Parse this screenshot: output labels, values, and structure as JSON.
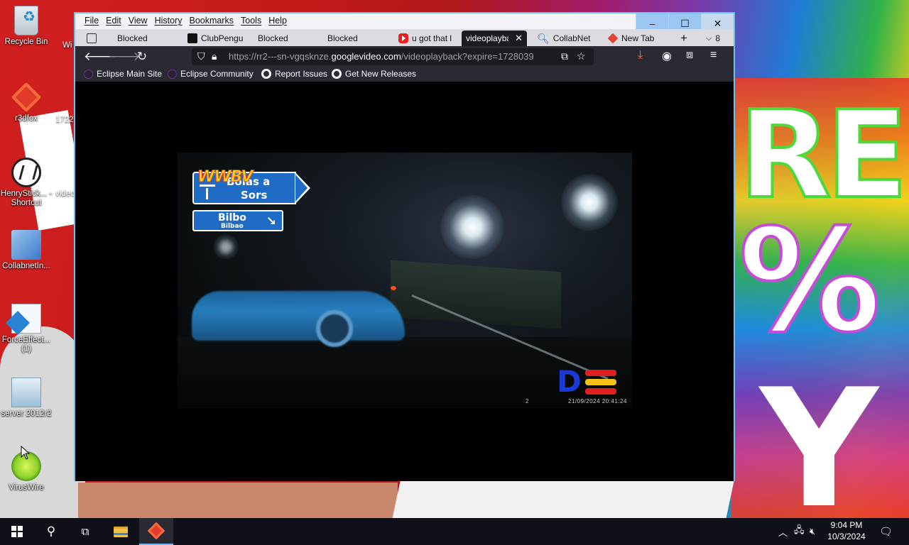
{
  "desktop": {
    "icons": [
      {
        "label": "Recycle Bin",
        "icon": "recycle-bin-icon"
      },
      {
        "label": "r3dfox",
        "icon": "r3dfox-icon"
      },
      {
        "label": "HenryStick... - Shortcut",
        "icon": "henry-stickmin-icon"
      },
      {
        "label": "CollabnetIn...",
        "icon": "collabnet-installer-icon"
      },
      {
        "label": "ForceEffect... (1)",
        "icon": "forceeffect-icon"
      },
      {
        "label": "server 2012r2",
        "icon": "server-icon"
      },
      {
        "label": "VirusWire",
        "icon": "viruswire-icon"
      }
    ],
    "clipped_labels": [
      "Wi",
      "1722",
      "video"
    ],
    "wallpaper_text": {
      "top": "RE",
      "middle": "%",
      "bottom": "Y"
    }
  },
  "browser": {
    "menu": [
      "File",
      "Edit",
      "View",
      "History",
      "Bookmarks",
      "Tools",
      "Help"
    ],
    "window_controls": {
      "minimize": "–",
      "maximize": "☐",
      "close": "✕"
    },
    "tabs": [
      {
        "label": "Blocked",
        "icon": "box-icon"
      },
      {
        "label": "ClubPengu",
        "icon": "clubpenguin-icon"
      },
      {
        "label": "Blocked",
        "icon": "none"
      },
      {
        "label": "Blocked",
        "icon": "none"
      },
      {
        "label": "u got that l",
        "icon": "youtube-icon"
      },
      {
        "label": "videoplayba",
        "icon": "none",
        "active": true
      },
      {
        "label": "CollabNet",
        "icon": "search-icon"
      },
      {
        "label": "New Tab",
        "icon": "r3dfox-icon"
      }
    ],
    "tab_count": "8",
    "url": {
      "prefix": "https://rr2---sn-vgqsknze.",
      "domain": "googlevideo.com",
      "path": "/videoplayback?expire=1728039"
    },
    "bookmarks": [
      {
        "label": "Eclipse Main Site",
        "icon": "eclipse-icon"
      },
      {
        "label": "Eclipse Community",
        "icon": "eclipse-icon"
      },
      {
        "label": "Report Issues",
        "icon": "github-icon"
      },
      {
        "label": "Get New Releases",
        "icon": "github-icon"
      }
    ]
  },
  "video": {
    "watermark": "WWBV",
    "sign1": {
      "line1": "Bolas a",
      "line2": "Sors"
    },
    "sign2": {
      "line1": "Bilbo",
      "line2": "Bilbao"
    },
    "logo": "D",
    "frame_number": "2",
    "timestamp": "21/09/2024  20:41:24"
  },
  "taskbar": {
    "time": "9:04 PM",
    "date": "10/3/2024"
  },
  "colors": {
    "browser_border": "#6ec1f2",
    "accent": "#ff6a55"
  }
}
